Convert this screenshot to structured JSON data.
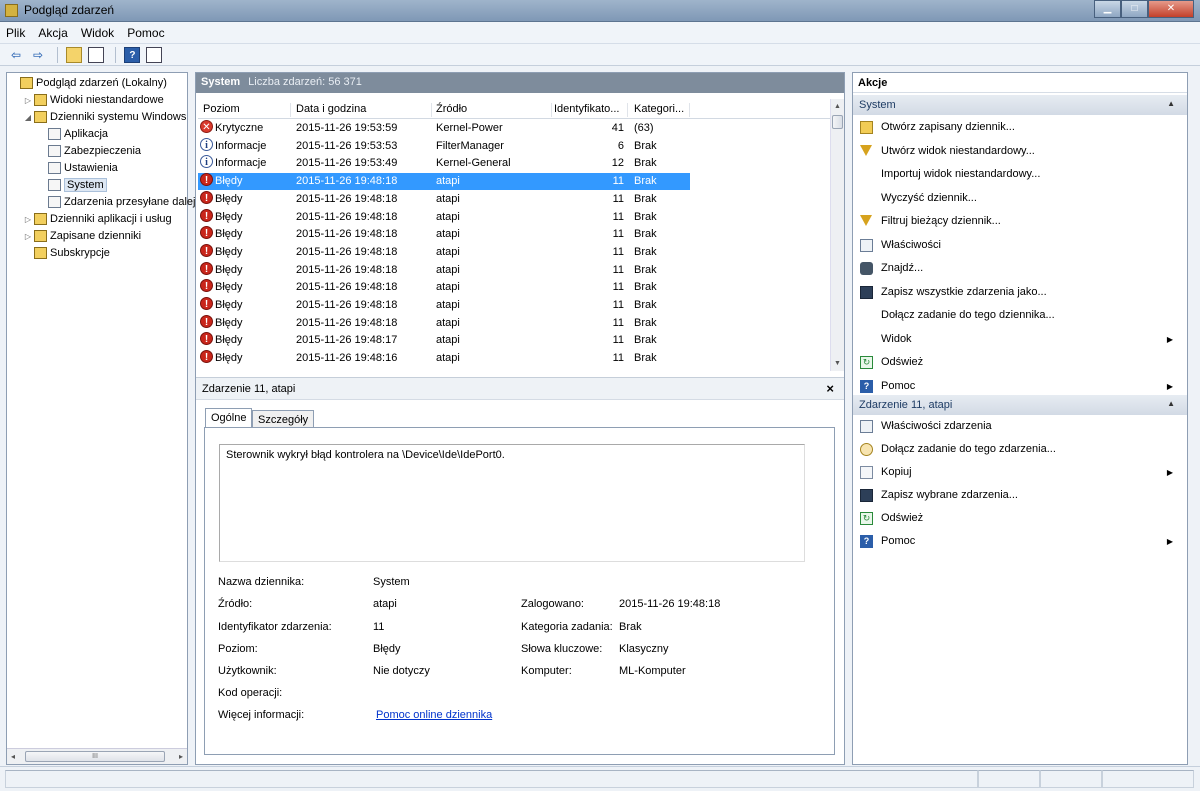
{
  "window": {
    "title": "Podgląd zdarzeń",
    "controls": [
      "minimize",
      "maximize",
      "close"
    ]
  },
  "menu": [
    "Plik",
    "Akcja",
    "Widok",
    "Pomoc"
  ],
  "toolbar": {
    "icons": [
      "back-arrow-icon",
      "forward-arrow-icon",
      "up-folder-icon",
      "show-hide-tree-icon",
      "help-icon",
      "properties-icon"
    ]
  },
  "tree": {
    "items": [
      {
        "label": "Podgląd zdarzeń (Lokalny)",
        "level": 0,
        "expander": "",
        "icon": "event-viewer-icon"
      },
      {
        "label": "Widoki niestandardowe",
        "level": 1,
        "expander": "▷",
        "icon": "folder-icon"
      },
      {
        "label": "Dzienniki systemu Windows",
        "level": 1,
        "expander": "◢",
        "icon": "folder-icon"
      },
      {
        "label": "Aplikacja",
        "level": 2,
        "expander": "",
        "icon": "log-icon"
      },
      {
        "label": "Zabezpieczenia",
        "level": 2,
        "expander": "",
        "icon": "log-icon"
      },
      {
        "label": "Ustawienia",
        "level": 2,
        "expander": "",
        "icon": "log-icon"
      },
      {
        "label": "System",
        "level": 2,
        "expander": "",
        "icon": "log-icon",
        "selected": true
      },
      {
        "label": "Zdarzenia przesyłane dalej",
        "level": 2,
        "expander": "",
        "icon": "log-icon"
      },
      {
        "label": "Dzienniki aplikacji i usług",
        "level": 1,
        "expander": "▷",
        "icon": "folder-icon"
      },
      {
        "label": "Zapisane dzienniki",
        "level": 1,
        "expander": "▷",
        "icon": "folder-icon"
      },
      {
        "label": "Subskrypcje",
        "level": 1,
        "expander": "",
        "icon": "subscription-icon"
      }
    ]
  },
  "hscroll": {
    "thumb_label": "III"
  },
  "log": {
    "name": "System",
    "count_label": "Liczba zdarzeń: 56 371"
  },
  "grid": {
    "headers": [
      "Poziom",
      "Data i godzina",
      "Źródło",
      "Identyfikato...",
      "Kategori..."
    ],
    "rows": [
      {
        "level": "Krytyczne",
        "type": "crit",
        "date": "2015-11-26 19:53:59",
        "source": "Kernel-Power",
        "id": "41",
        "cat": "(63)"
      },
      {
        "level": "Informacje",
        "type": "info",
        "date": "2015-11-26 19:53:53",
        "source": "FilterManager",
        "id": "6",
        "cat": "Brak"
      },
      {
        "level": "Informacje",
        "type": "info",
        "date": "2015-11-26 19:53:49",
        "source": "Kernel-General",
        "id": "12",
        "cat": "Brak"
      },
      {
        "level": "Błędy",
        "type": "err",
        "date": "2015-11-26 19:48:18",
        "source": "atapi",
        "id": "11",
        "cat": "Brak",
        "selected": true
      },
      {
        "level": "Błędy",
        "type": "err",
        "date": "2015-11-26 19:48:18",
        "source": "atapi",
        "id": "11",
        "cat": "Brak"
      },
      {
        "level": "Błędy",
        "type": "err",
        "date": "2015-11-26 19:48:18",
        "source": "atapi",
        "id": "11",
        "cat": "Brak"
      },
      {
        "level": "Błędy",
        "type": "err",
        "date": "2015-11-26 19:48:18",
        "source": "atapi",
        "id": "11",
        "cat": "Brak"
      },
      {
        "level": "Błędy",
        "type": "err",
        "date": "2015-11-26 19:48:18",
        "source": "atapi",
        "id": "11",
        "cat": "Brak"
      },
      {
        "level": "Błędy",
        "type": "err",
        "date": "2015-11-26 19:48:18",
        "source": "atapi",
        "id": "11",
        "cat": "Brak"
      },
      {
        "level": "Błędy",
        "type": "err",
        "date": "2015-11-26 19:48:18",
        "source": "atapi",
        "id": "11",
        "cat": "Brak"
      },
      {
        "level": "Błędy",
        "type": "err",
        "date": "2015-11-26 19:48:18",
        "source": "atapi",
        "id": "11",
        "cat": "Brak"
      },
      {
        "level": "Błędy",
        "type": "err",
        "date": "2015-11-26 19:48:18",
        "source": "atapi",
        "id": "11",
        "cat": "Brak"
      },
      {
        "level": "Błędy",
        "type": "err",
        "date": "2015-11-26 19:48:17",
        "source": "atapi",
        "id": "11",
        "cat": "Brak"
      },
      {
        "level": "Błędy",
        "type": "err",
        "date": "2015-11-26 19:48:16",
        "source": "atapi",
        "id": "11",
        "cat": "Brak"
      }
    ]
  },
  "detail": {
    "title": "Zdarzenie 11, atapi",
    "tabs": [
      "Ogólne",
      "Szczegóły"
    ],
    "description": "Sterownik wykrył błąd kontrolera na \\Device\\Ide\\IdePort0.",
    "fields": {
      "log_name_label": "Nazwa dziennika:",
      "log_name": "System",
      "source_label": "Źródło:",
      "source": "atapi",
      "logged_label": "Zalogowano:",
      "logged": "2015-11-26 19:48:18",
      "event_id_label": "Identyfikator zdarzenia:",
      "event_id": "11",
      "task_cat_label": "Kategoria zadania:",
      "task_cat": "Brak",
      "level_label": "Poziom:",
      "level": "Błędy",
      "keywords_label": "Słowa kluczowe:",
      "keywords": "Klasyczny",
      "user_label": "Użytkownik:",
      "user": "Nie dotyczy",
      "computer_label": "Komputer:",
      "computer": "ML-Komputer",
      "opcode_label": "Kod operacji:",
      "more_info_label": "Więcej informacji:",
      "more_info_link": "Pomoc online dziennika"
    }
  },
  "actions": {
    "title": "Akcje",
    "section1": {
      "title": "System",
      "items": [
        {
          "label": "Otwórz zapisany dziennik...",
          "icon": "open-log-icon"
        },
        {
          "label": "Utwórz widok niestandardowy...",
          "icon": "filter-icon"
        },
        {
          "label": "Importuj widok niestandardowy...",
          "icon": ""
        },
        {
          "label": "Wyczyść dziennik...",
          "icon": ""
        },
        {
          "label": "Filtruj bieżący dziennik...",
          "icon": "filter-icon"
        },
        {
          "label": "Właściwości",
          "icon": "properties-icon"
        },
        {
          "label": "Znajdź...",
          "icon": "find-icon"
        },
        {
          "label": "Zapisz wszystkie zdarzenia jako...",
          "icon": "save-icon"
        },
        {
          "label": "Dołącz zadanie do tego dziennika...",
          "icon": ""
        },
        {
          "label": "Widok",
          "icon": "",
          "submenu": true
        },
        {
          "label": "Odśwież",
          "icon": "refresh-icon"
        },
        {
          "label": "Pomoc",
          "icon": "help-icon",
          "submenu": true
        }
      ]
    },
    "section2": {
      "title": "Zdarzenie 11, atapi",
      "items": [
        {
          "label": "Właściwości zdarzenia",
          "icon": "properties-icon"
        },
        {
          "label": "Dołącz zadanie do tego zdarzenia...",
          "icon": "task-icon"
        },
        {
          "label": "Kopiuj",
          "icon": "copy-icon",
          "submenu": true
        },
        {
          "label": "Zapisz wybrane zdarzenia...",
          "icon": "save-icon"
        },
        {
          "label": "Odśwież",
          "icon": "refresh-icon"
        },
        {
          "label": "Pomoc",
          "icon": "help-icon",
          "submenu": true
        }
      ]
    }
  }
}
